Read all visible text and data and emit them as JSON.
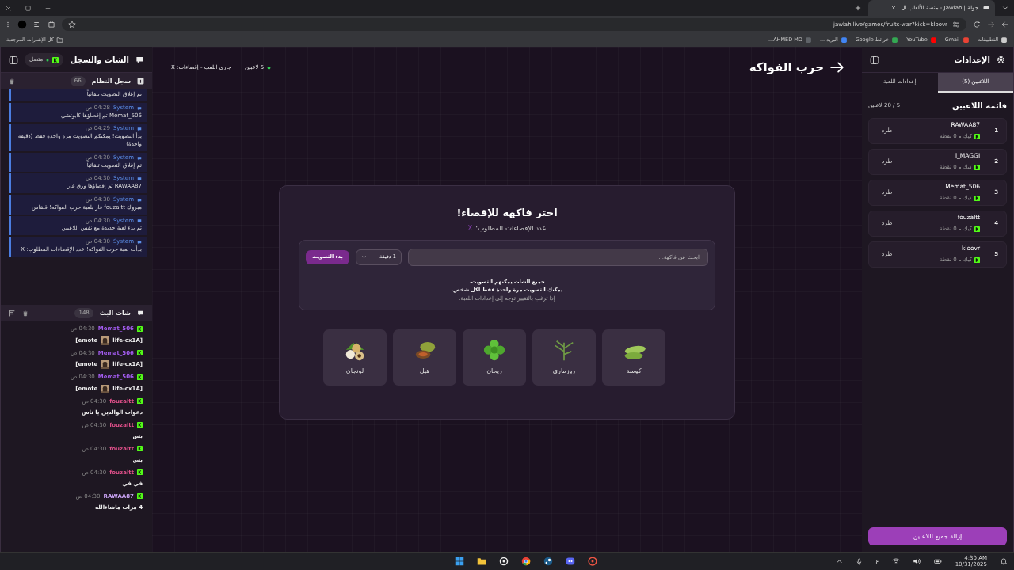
{
  "browser": {
    "tab_title": "جولة | Jawlah - منصة الألعاب ال",
    "url": "jawlah.live/games/fruits-war?kick=kloovr",
    "bookmarks": [
      "التطبيقات",
      "Gmail",
      "YouTube",
      "خرائط Google",
      "البريد ...",
      "AHMED MO..."
    ],
    "all_bookmarks": "كل الإشارات المرجعية"
  },
  "settings_panel": {
    "title": "الإعدادات",
    "tabs": [
      {
        "label": "اللاعبين (5)",
        "selected": true
      },
      {
        "label": "إعدادات اللعبة",
        "selected": false
      }
    ],
    "list_title": "قائمة اللاعبين",
    "list_count": "5 / 20 لاعبين",
    "players": [
      {
        "rank": "1",
        "name": "RAWAA87",
        "platform": "كيك",
        "points": "0 نقطة",
        "kick_label": "طرد"
      },
      {
        "rank": "2",
        "name": "l_MAGGI",
        "platform": "كيك",
        "points": "0 نقطة",
        "kick_label": "طرد"
      },
      {
        "rank": "3",
        "name": "Memat_506",
        "platform": "كيك",
        "points": "0 نقطة",
        "kick_label": "طرد"
      },
      {
        "rank": "4",
        "name": "fouzaltt",
        "platform": "كيك",
        "points": "0 نقطة",
        "kick_label": "طرد"
      },
      {
        "rank": "5",
        "name": "kloovr",
        "platform": "كيك",
        "points": "0 نقطة",
        "kick_label": "طرد"
      }
    ],
    "remove_all": "إزالة جميع اللاعبين"
  },
  "game": {
    "title": "حرب الفواكه",
    "players_status": "5 لاعبين",
    "game_status": "جاري اللعب - إقصاءات: X",
    "vote": {
      "title": "اختر فاكهة للإقصاء!",
      "subtitle": "عدد الإقصاءات المطلوب:",
      "eliminations": "X",
      "search_placeholder": "ابحث عن فاكهة...",
      "duration": "1 دقيقة",
      "start_button": "بدء التصويت",
      "notes": [
        "جميع الشات يمكنهم التصويت.",
        "يمكنك التصويت مرة واحدة فقط لكل شخص."
      ],
      "hint": "إذا ترغب بالتغيير توجه إلى إعدادات اللعبة.",
      "fruits": [
        "كوسة",
        "روزماري",
        "ريحان",
        "هيل",
        "لونجان"
      ]
    }
  },
  "chat_panel": {
    "title": "الشات والسجل",
    "connection": {
      "label": "متصل",
      "connected": true
    },
    "system_log": {
      "title": "سجل النظام",
      "count": "66",
      "entries": [
        {
          "text": "تم إغلاق التصويت تلقائياً"
        },
        {
          "sender": "System",
          "time": "04:28 ص",
          "text": "Memat_506 تم إقصاؤها كابوتشي"
        },
        {
          "sender": "System",
          "time": "04:29 ص",
          "text": "بدأ التصويت! يمكنكم التصويت مرة واحدة فقط (دقيقة واحدة)"
        },
        {
          "sender": "System",
          "time": "04:30 ص",
          "text": "تم إغلاق التصويت تلقائياً"
        },
        {
          "sender": "System",
          "time": "04:30 ص",
          "text": "RAWAA87 تم إقصاؤها ورق غار"
        },
        {
          "sender": "System",
          "time": "04:30 ص",
          "text": "مبروك fouzaltt فاز بلعبة حرب الفواكه! قلقاس"
        },
        {
          "sender": "System",
          "time": "04:30 ص",
          "text": "تم بدء لعبة جديدة مع نفس اللاعبين"
        },
        {
          "sender": "System",
          "time": "04:30 ص",
          "text": "بدأت لعبة حرب الفواكه! عدد الإقصاءات المطلوب: X"
        }
      ]
    },
    "stream_chat": {
      "title": "شات البث",
      "count": "148",
      "messages": [
        {
          "user": "Memat_506",
          "color": "#a35cf0",
          "time": "04:30 ص",
          "text": "[emote",
          "emote": "life-cx1A]"
        },
        {
          "user": "Memat_506",
          "color": "#a35cf0",
          "time": "04:30 ص",
          "text": "[emote",
          "emote": "life-cx1A]"
        },
        {
          "user": "Memat_506",
          "color": "#a35cf0",
          "time": "04:30 ص",
          "text": "[emote",
          "emote": "life-cx1A]"
        },
        {
          "user": "fouzaltt",
          "color": "#e0508a",
          "time": "04:30 ص",
          "text": "دعوات الوالدين يا ناس"
        },
        {
          "user": "fouzaltt",
          "color": "#e0508a",
          "time": "04:30 ص",
          "text": "بس"
        },
        {
          "user": "fouzaltt",
          "color": "#e0508a",
          "time": "04:30 ص",
          "text": "بس"
        },
        {
          "user": "fouzaltt",
          "color": "#e0508a",
          "time": "04:30 ص",
          "text": "في في"
        },
        {
          "user": "RAWAA87",
          "color": "#c8a2f2",
          "time": "04:30 ص",
          "text": "4 مرات ماشاءالله"
        }
      ]
    }
  },
  "taskbar": {
    "language": "ع",
    "time": "4:30 AM",
    "date": "10/31/2025"
  }
}
